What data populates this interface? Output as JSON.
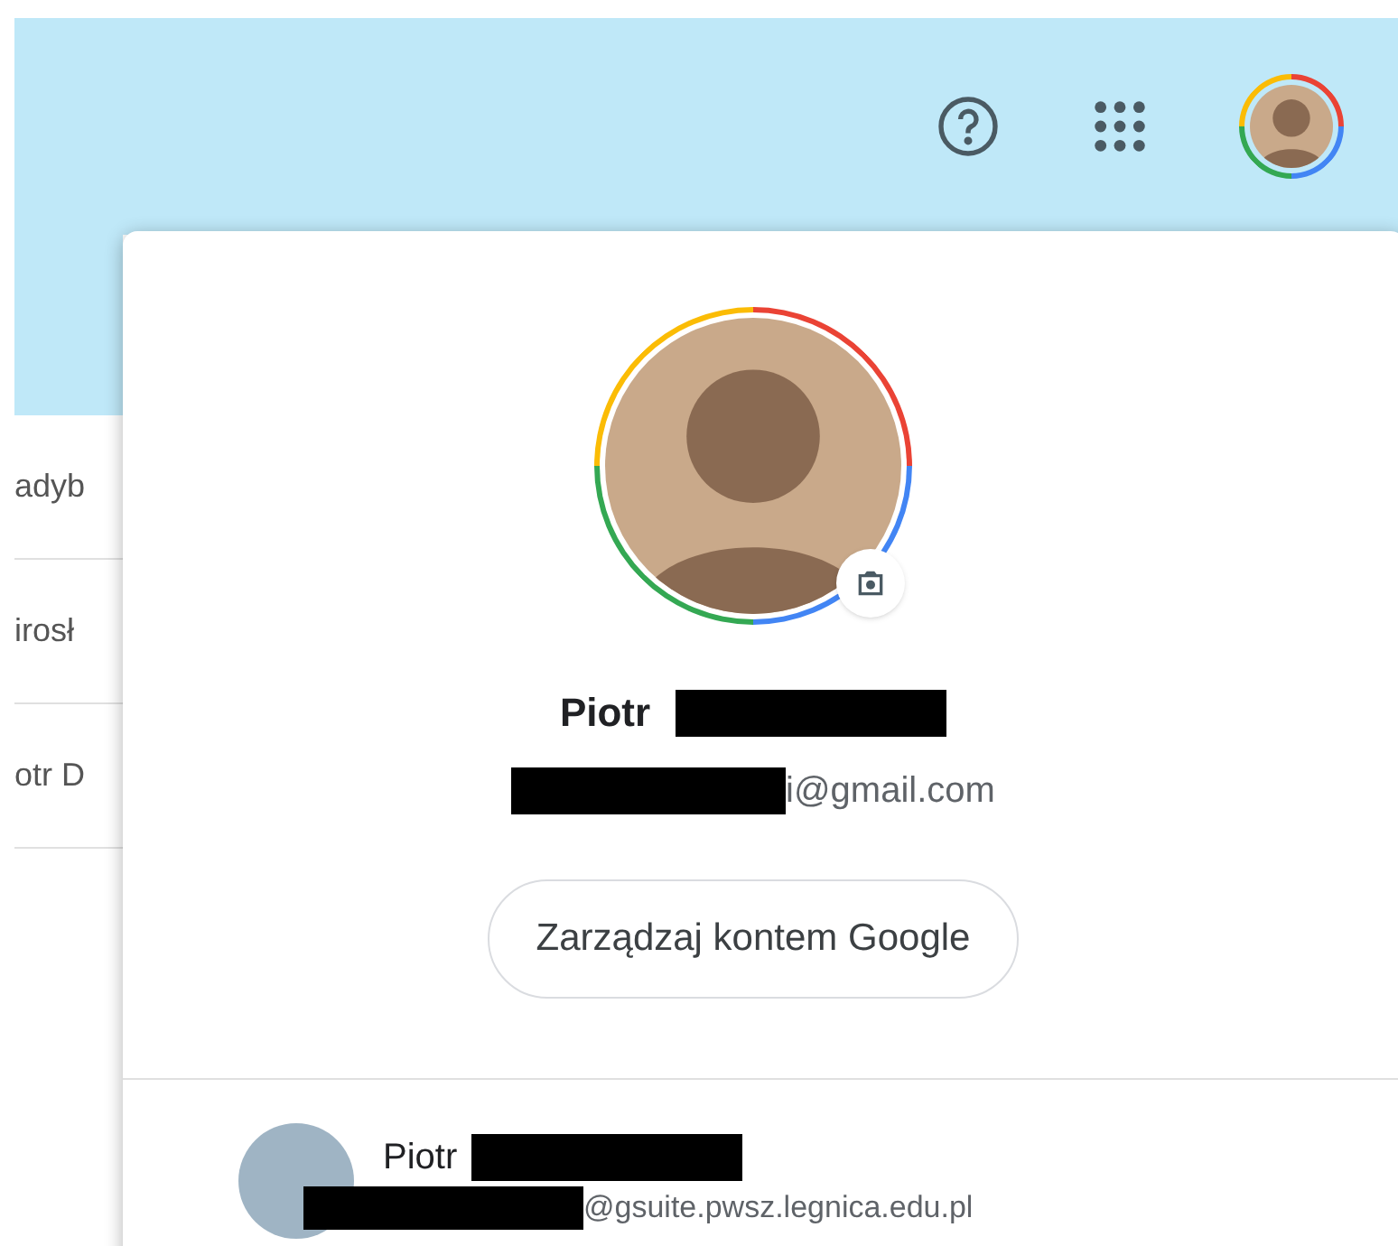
{
  "background_list": {
    "rows": [
      "adyb",
      "irosł",
      "otr D"
    ]
  },
  "account_menu": {
    "name": "Piotr",
    "email": "i@gmail.com",
    "manage_button": "Zarządzaj kontem Google",
    "accounts": [
      {
        "name": "Piotr",
        "email": "@gsuite.pwsz.legnica.edu.pl"
      }
    ]
  }
}
